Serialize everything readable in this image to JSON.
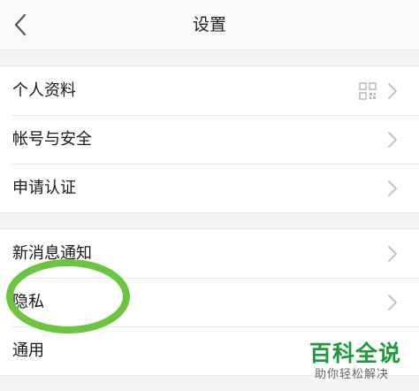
{
  "nav": {
    "title": "设置",
    "back_icon": "chevron-left-icon"
  },
  "groups": [
    {
      "items": [
        {
          "label": "个人资料",
          "icon": "qr-code-icon"
        },
        {
          "label": "帐号与安全"
        },
        {
          "label": "申请认证"
        }
      ]
    },
    {
      "items": [
        {
          "label": "新消息通知"
        },
        {
          "label": "隐私"
        },
        {
          "label": "通用"
        }
      ]
    }
  ],
  "annotation": {
    "color": "#6cc53f"
  },
  "watermark": {
    "title": "百科全说",
    "subtitle": "助你轻松解决",
    "color": "#1f9a3a"
  },
  "colors": {
    "background": "#f4f4f6",
    "row": "#ffffff",
    "chevron": "#c4c4c4"
  }
}
